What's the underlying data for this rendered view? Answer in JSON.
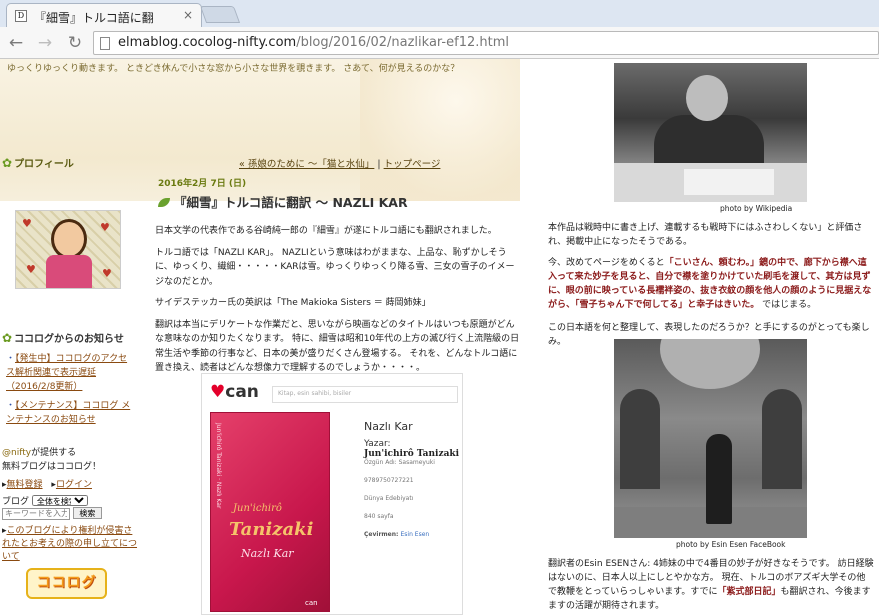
{
  "browser": {
    "tab_title": "『細雪』トルコ語に翻",
    "tab_close": "×",
    "url_host": "elmablog.cocolog-nifty.com",
    "url_path": "/blog/2016/02/nazlikar-ef12.html"
  },
  "header": {
    "tagline": "ゆっくりゆっくり動きます。 ときどき休んで小さな窓から小さな世界を覗きます。 さあて、何が見えるのかな？",
    "profile_label": "プロフィール",
    "prev_post": "« 孫娘のために ～「猫と水仙」",
    "separator": " | ",
    "top_page": "トップページ"
  },
  "post": {
    "date": "2016年2月 7日 (日)",
    "title": "『細雪』トルコ語に翻訳 ～ NAZLI KAR",
    "paragraphs": [
      "日本文学の代表作である谷崎純一郎の『細雪』が遂にトルコ語にも翻訳されました。",
      "トルコ語では「NAZLI KAR」。 NAZLIという意味はわがままな、上品な、恥ずかしそうに、ゆっくり、繊細・・・・・KARは雪。ゆっくりゆっくり降る雪、三女の雪子のイメージなのだとか。",
      "サイデステッカー氏の英訳は「The Makioka Sisters ＝ 蒔岡姉妹」",
      "翻訳は本当にデリケートな作業だと、思いながら映画などのタイトルはいつも原題がどんな意味なのか知りたくなります。 特に、細雪は昭和10年代の上方の滅び行く上流階級の日常生活や季節の行事など、日本の美が盛りだくさん登場する。 それを、どんなトルコ語に置き換え、読者はどんな想像力で理解するのでしょうか・・・・。"
    ],
    "book": {
      "store_logo": "can",
      "search_placeholder": "Kitap, esin sahibi, bisiler",
      "cover_spine": "Jun'ichirô Tanizaki · Nazlı Kar",
      "cover_author_first": "Jun'ichirô",
      "cover_author_last": "Tanizaki",
      "cover_title": "Nazlı Kar",
      "cover_publisher": "can",
      "title": "Nazlı Kar",
      "author_label": "Yazar:",
      "author": "Jun'ichirô Tanizaki",
      "original": "Özgün Adı: Sasameyuki",
      "isbn": "9789750727221",
      "series": "Dünya Edebiyatı",
      "pages": "840 sayfa",
      "translator_label": "Çevirmen:",
      "translator": "Esin Esen"
    }
  },
  "sidebar": {
    "news_heading": "ココログからのお知らせ",
    "news": [
      {
        "marker": "・",
        "text": "【発生中】ココログのアクセス解析関連で表示遅延（2016/2/8更新）"
      },
      {
        "marker": "・",
        "text": "【メンテナンス】ココログ メンテナンスのお知らせ"
      }
    ],
    "provided_brand": "@nifty",
    "provided_text": "が提供する",
    "free_blog": "無料ブログはココログ！",
    "link_signup": "無料登録",
    "link_login": "ログイン",
    "search_prefix": "ブログ",
    "search_scope": "全体を検索",
    "search_placeholder": "キーワードを入力",
    "search_button": "検索",
    "report": "このブログにより権利が侵害されたとお考えの際の申し立てについて",
    "logo": "ココログ"
  },
  "right": {
    "caption1": "photo by Wikipedia",
    "p1": "本作品は戦時中に書き上げ、連載するも戦時下にはふさわしくない」と評価され、掲載中止になったそうである。",
    "p2_a": "今、改めてページをめくると",
    "p2_b": "「こいさん、頼むわ。」鏡の中で、廊下から襟へ這入って来た妙子を見ると、自分で襟を塗りかけていた刷毛を渡して、其方は見ずに、眼の前に映っている長襦袢姿の、抜き衣紋の顔を他人の顔のように見据えながら、「雪子ちゃん下で何してる」と幸子はきいた。",
    "p2_c": " ではじまる。",
    "p3": "この日本語を何と整理して、表現したのだろうか？と手にするのがとっても楽しみ。",
    "caption2": "photo by Esin Esen FaceBook",
    "p4_a": "翻訳者のEsin ESENさん: 4姉妹の中で4番目の妙子が好きなそうです。 訪日経験はないのに、日本人以上にしとやかな方。 現在、トルコのボアズギ大学その他で教鞭をとっていらっしゃいます。すでに",
    "p4_b": "「紫式部日記」",
    "p4_c": "も翻訳され、今後ますますの活躍が期待されます。"
  },
  "colors": {
    "accent_green": "#6a9a20",
    "link_brown": "#8a4a10",
    "highlight_red": "#8b1a1a"
  }
}
